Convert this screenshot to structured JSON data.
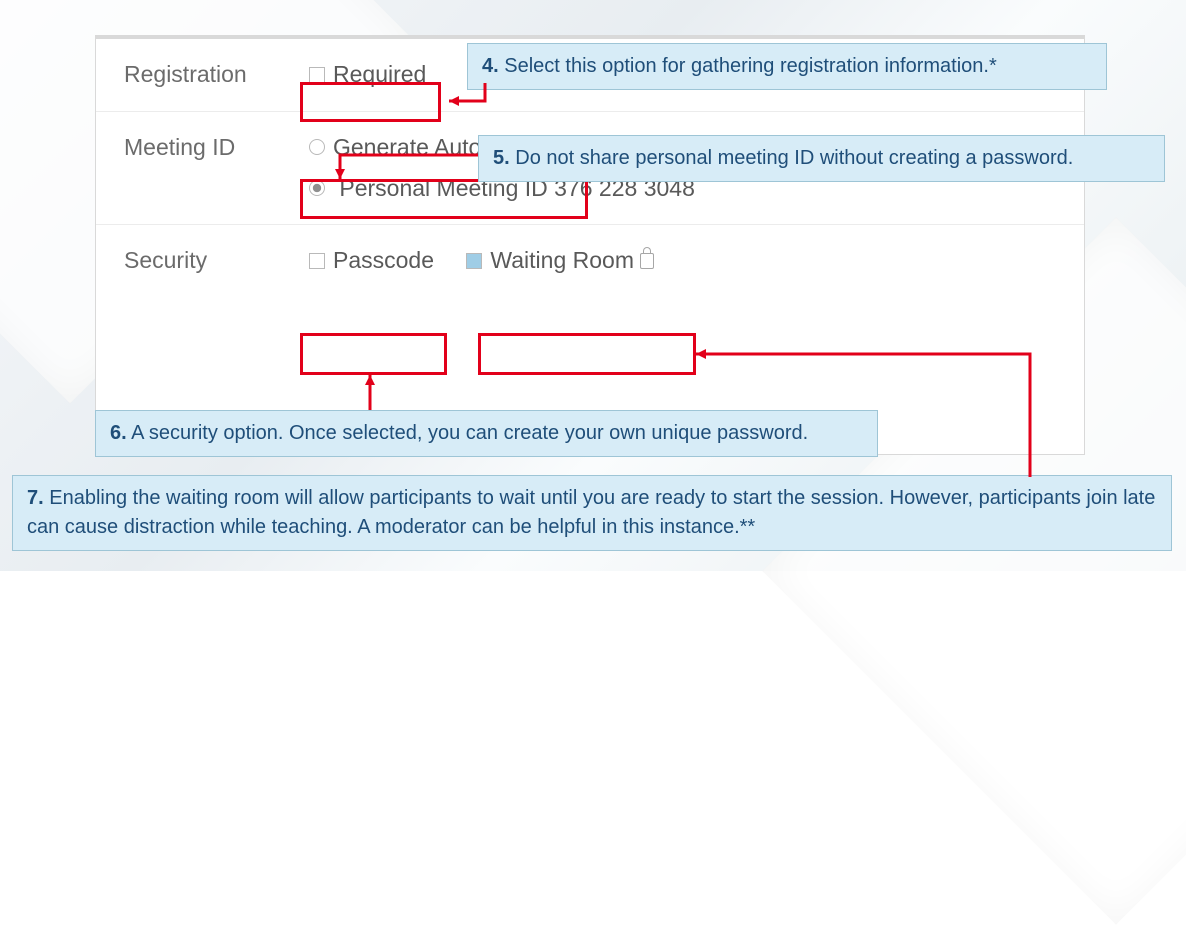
{
  "form": {
    "rows": [
      {
        "label": "Registration",
        "options": [
          {
            "kind": "checkbox",
            "checked": false,
            "text": "Required"
          }
        ]
      },
      {
        "label": "Meeting ID",
        "options": [
          {
            "kind": "radio",
            "checked": false,
            "text": "Generate Automatically"
          },
          {
            "kind": "radio",
            "checked": true,
            "text": "Personal Meeting ID 376 228 3048"
          }
        ]
      },
      {
        "label": "Security",
        "options": [
          {
            "kind": "checkbox",
            "checked": false,
            "text": "Passcode"
          },
          {
            "kind": "checkbox",
            "checked": true,
            "text": "Waiting Room",
            "lock": true
          }
        ]
      }
    ]
  },
  "callouts": {
    "c4": {
      "num": "4.",
      "text": "Select this option for gathering registration information.*"
    },
    "c5": {
      "num": "5.",
      "text": "Do not share personal meeting ID without creating a password."
    },
    "c6": {
      "num": "6.",
      "text": "A security option. Once selected, you can create your own unique password."
    },
    "c7": {
      "num": "7.",
      "text": "Enabling the waiting room will allow participants to wait until you are ready to start the session. However, participants join late can cause distraction while teaching. A moderator can be helpful in this instance.**"
    }
  }
}
